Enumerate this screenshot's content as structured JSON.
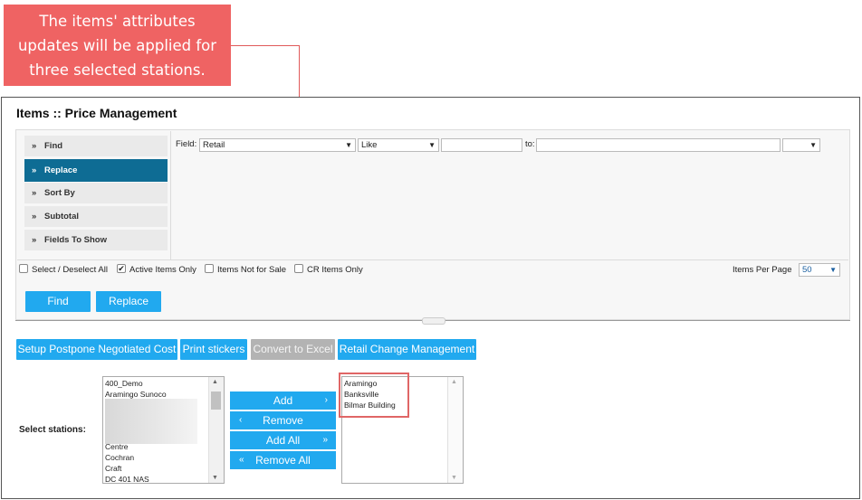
{
  "callout": {
    "text_lines": [
      "The items' attributes",
      "updates will be applied for",
      "three selected stations."
    ]
  },
  "page": {
    "title": "Items :: Price Management"
  },
  "menu": [
    {
      "label": "Find",
      "active": false
    },
    {
      "label": "Replace",
      "active": true
    },
    {
      "label": "Sort By",
      "active": false
    },
    {
      "label": "Subtotal",
      "active": false
    },
    {
      "label": "Fields To Show",
      "active": false
    }
  ],
  "menu_chevron": "»",
  "filter": {
    "field_label": "Field:",
    "field_value": "Retail",
    "operator_value": "Like",
    "value_input": "",
    "to_label": "to:",
    "to_input": "",
    "extra_select_value": ""
  },
  "checks": {
    "select_all": {
      "label": "Select / Deselect All",
      "checked": false
    },
    "active_only": {
      "label": "Active Items Only",
      "checked": true
    },
    "not_for_sale": {
      "label": "Items Not for Sale",
      "checked": false
    },
    "cr_items": {
      "label": "CR Items Only",
      "checked": false
    }
  },
  "per_page": {
    "label": "Items Per Page",
    "value": "50"
  },
  "actions": {
    "find": "Find",
    "replace": "Replace"
  },
  "toolbar": {
    "setup_postpone": "Setup Postpone Negotiated Cost",
    "print_stickers": "Print stickers",
    "convert_excel": "Convert to Excel",
    "retail_change": "Retail Change Management"
  },
  "stations": {
    "label": "Select stations:",
    "available_top": [
      "400_Demo",
      "Aramingo Sunoco"
    ],
    "available_bottom": [
      "Centre",
      "Cochran",
      "Craft",
      "DC 401 NAS"
    ],
    "selected": [
      "Aramingo",
      "Banksville",
      "Bilmar Building"
    ]
  },
  "move_buttons": {
    "add": "Add",
    "remove": "Remove",
    "add_all": "Add All",
    "remove_all": "Remove All"
  },
  "icons": {
    "dropdown": "dropdown-arrow-icon",
    "check": "check-icon"
  },
  "colors": {
    "accent": "#21a9ef",
    "active_menu": "#0e6c94",
    "callout": "#ef6363",
    "disabled": "#b3b3b3"
  }
}
